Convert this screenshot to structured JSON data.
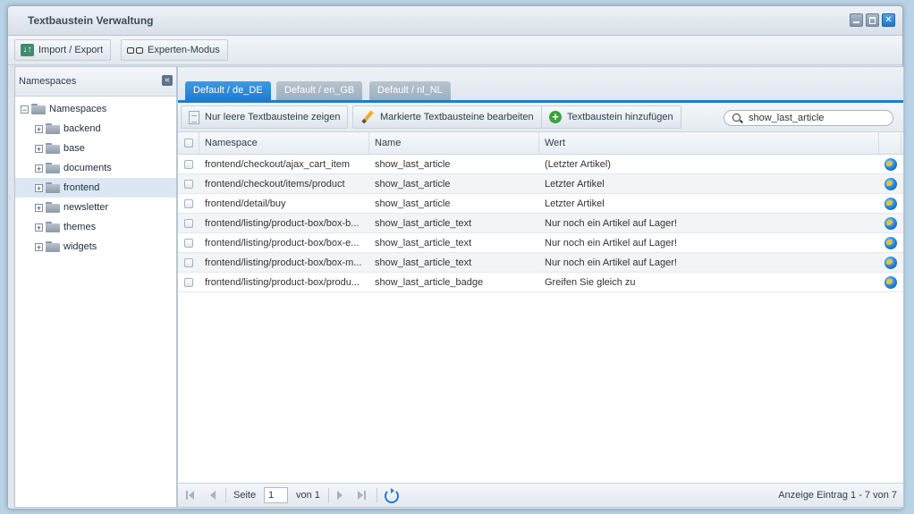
{
  "window": {
    "title": "Textbaustein Verwaltung"
  },
  "toolbar": {
    "import_export": "Import / Export",
    "expert_mode": "Experten-Modus"
  },
  "namespaces_panel": {
    "title": "Namespaces",
    "root": "Namespaces",
    "items": [
      {
        "label": "backend"
      },
      {
        "label": "base"
      },
      {
        "label": "documents"
      },
      {
        "label": "frontend",
        "selected": true
      },
      {
        "label": "newsletter"
      },
      {
        "label": "themes"
      },
      {
        "label": "widgets"
      }
    ]
  },
  "tabs": [
    {
      "label": "Default / de_DE",
      "active": true
    },
    {
      "label": "Default / en_GB"
    },
    {
      "label": "Default / nl_NL"
    }
  ],
  "grid_toolbar": {
    "show_empty": "Nur leere Textbausteine zeigen",
    "edit_marked": "Markierte Textbausteine bearbeiten",
    "add": "Textbaustein hinzufügen",
    "search_value": "show_last_article"
  },
  "grid": {
    "columns": [
      "Namespace",
      "Name",
      "Wert"
    ],
    "rows": [
      {
        "namespace": "frontend/checkout/ajax_cart_item",
        "name": "show_last_article",
        "value": "(Letzter Artikel)"
      },
      {
        "namespace": "frontend/checkout/items/product",
        "name": "show_last_article",
        "value": "Letzter Artikel"
      },
      {
        "namespace": "frontend/detail/buy",
        "name": "show_last_article",
        "value": "Letzter Artikel"
      },
      {
        "namespace": "frontend/listing/product-box/box-b...",
        "name": "show_last_article_text",
        "value": "Nur noch ein Artikel auf Lager!"
      },
      {
        "namespace": "frontend/listing/product-box/box-e...",
        "name": "show_last_article_text",
        "value": "Nur noch ein Artikel auf Lager!"
      },
      {
        "namespace": "frontend/listing/product-box/box-m...",
        "name": "show_last_article_text",
        "value": "Nur noch ein Artikel auf Lager!"
      },
      {
        "namespace": "frontend/listing/product-box/produ...",
        "name": "show_last_article_badge",
        "value": "Greifen Sie gleich zu"
      }
    ]
  },
  "pager": {
    "page_label": "Seite",
    "page_value": "1",
    "of_label": "von 1",
    "info": "Anzeige Eintrag 1 - 7 von 7"
  }
}
